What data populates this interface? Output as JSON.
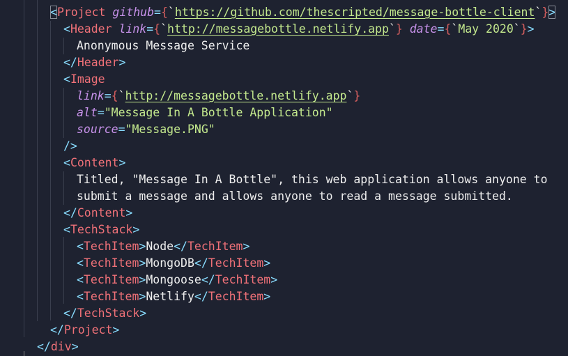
{
  "lines": {
    "l1": {
      "open": "<",
      "tag": "Project",
      "attr": "github",
      "eq": "=",
      "brace_open": "{",
      "tick_open": "`",
      "url": "https://github.com/thescripted/message-bottle-client",
      "tick_close": "`",
      "brace_close": "}",
      "close": ">"
    },
    "l2": {
      "open": "<",
      "tag": "Header",
      "attr1": "link",
      "eq1": "=",
      "brace1_open": "{",
      "tick1_open": "`",
      "url": "http://messagebottle.netlify.app",
      "tick1_close": "`",
      "brace1_close": "}",
      "attr2": "date",
      "eq2": "=",
      "brace2_open": "{",
      "tick2_open": "`",
      "date": "May 2020",
      "tick2_close": "`",
      "brace2_close": "}",
      "close": ">"
    },
    "l3": {
      "text": "Anonymous Message Service"
    },
    "l4": {
      "open": "</",
      "tag": "Header",
      "close": ">"
    },
    "l5": {
      "open": "<",
      "tag": "Image"
    },
    "l6": {
      "attr": "link",
      "eq": "=",
      "brace_open": "{",
      "tick_open": "`",
      "url": "http://messagebottle.netlify.app",
      "tick_close": "`",
      "brace_close": "}"
    },
    "l7": {
      "attr": "alt",
      "eq": "=",
      "value": "\"Message In A Bottle Application\""
    },
    "l8": {
      "attr": "source",
      "eq": "=",
      "value": "\"Message.PNG\""
    },
    "l9": {
      "close": "/>"
    },
    "l10": {
      "open": "<",
      "tag": "Content",
      "close": ">"
    },
    "l11": {
      "text": "Titled, \"Message In A Bottle\", this web application allows anyone to"
    },
    "l12": {
      "text": "submit a message and allows anyone to read a message submitted."
    },
    "l13": {
      "open": "</",
      "tag": "Content",
      "close": ">"
    },
    "l14": {
      "open": "<",
      "tag": "TechStack",
      "close": ">"
    },
    "l15": {
      "open": "<",
      "tag": "TechItem",
      "close": ">",
      "text": "Node",
      "end_open": "</",
      "end_tag": "TechItem",
      "end_close": ">"
    },
    "l16": {
      "open": "<",
      "tag": "TechItem",
      "close": ">",
      "text": "MongoDB",
      "end_open": "</",
      "end_tag": "TechItem",
      "end_close": ">"
    },
    "l17": {
      "open": "<",
      "tag": "TechItem",
      "close": ">",
      "text": "Mongoose",
      "end_open": "</",
      "end_tag": "TechItem",
      "end_close": ">"
    },
    "l18": {
      "open": "<",
      "tag": "TechItem",
      "close": ">",
      "text": "Netlify",
      "end_open": "</",
      "end_tag": "TechItem",
      "end_close": ">"
    },
    "l19": {
      "open": "</",
      "tag": "TechStack",
      "close": ">"
    },
    "l20": {
      "open": "</",
      "tag": "Project",
      "close": ">"
    },
    "l21": {
      "open": "</",
      "tag": "div",
      "close": ">"
    }
  },
  "colors": {
    "background": "#1e2230",
    "tag": "#f07178",
    "attribute": "#c792ea",
    "string": "#c3e88d",
    "brace": "#d75f5f",
    "punctuation": "#89ddff",
    "text": "#eeeeee"
  }
}
